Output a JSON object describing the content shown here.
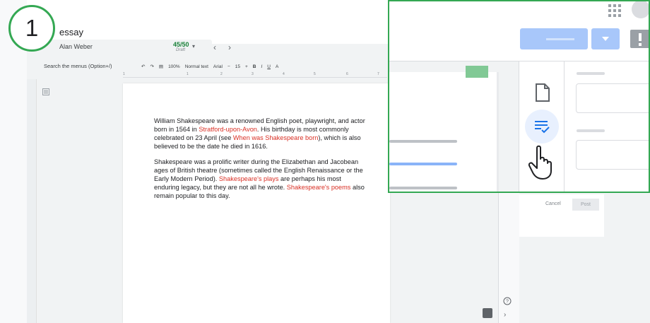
{
  "step": {
    "number": "1"
  },
  "document": {
    "title": "essay",
    "student_name": "Alan Weber",
    "grade": "45/50",
    "grade_status": "Draft"
  },
  "navigation": {
    "prev_icon": "‹",
    "next_icon": "›",
    "dropdown_icon": "▾"
  },
  "toolbar": {
    "search_label": "Search the menus (Option+/)",
    "zoom": "100%",
    "style": "Normal text",
    "font": "Arial",
    "font_size": "15",
    "minus": "−",
    "plus": "+",
    "bold": "B",
    "italic": "I",
    "underline": "U",
    "text_color": "A"
  },
  "ruler": {
    "ticks": [
      "1",
      "1",
      "2",
      "3",
      "4",
      "5",
      "6",
      "7"
    ]
  },
  "content": {
    "p1_a": "William Shakespeare was a renowned English poet, playwright, and actor born in 1564 in ",
    "p1_link1": "Stratford-upon-Avon",
    "p1_b": ". His birthday is most commonly celebrated on 23 April (see ",
    "p1_link2": "When was Shakespeare born",
    "p1_c": "), which is also believed to be the date he died in 1616.",
    "p2_a": "Shakespeare was a prolific writer during the Elizabethan and Jacobean ages of British theatre (sometimes called the English Renaissance or the Early Modern Period). ",
    "p2_link1": "Shakespeare's plays",
    "p2_b": " are perhaps his most enduring legacy, but they are not all he wrote. ",
    "p2_link2": "Shakespeare's poems",
    "p2_c": " also remain popular to this day."
  },
  "grading": {
    "cancel": "Cancel",
    "post": "Post"
  },
  "colors": {
    "callout_border": "#34a853",
    "link": "#d93025",
    "grade": "#188038",
    "return_button": "#a8c7fa"
  },
  "icons": [
    "apps-icon",
    "account-icon",
    "report-icon",
    "file-icon",
    "rubric-icon",
    "hand-cursor-icon",
    "help-icon",
    "outline-icon"
  ]
}
